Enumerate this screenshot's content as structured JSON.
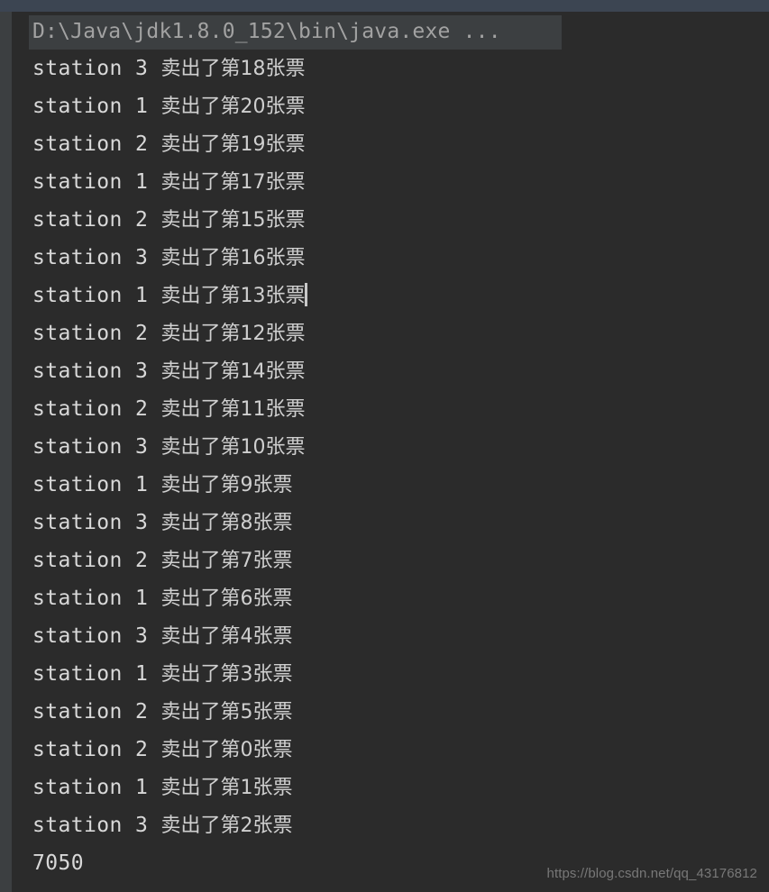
{
  "toolbar": {
    "progress_percent": 26,
    "track_color": "#3c4552",
    "fill_color": "#4a86c8"
  },
  "console": {
    "header_command": "D:\\Java\\jdk1.8.0_152\\bin\\java.exe ...",
    "background_color": "#2b2b2b",
    "gutter_color": "#3c3f41",
    "text_color": "#d4d4d4",
    "caret_line_index": 6,
    "lines": [
      {
        "ascii": "station 3 ",
        "cjk": "卖出了第18张票"
      },
      {
        "ascii": "station 1 ",
        "cjk": "卖出了第20张票"
      },
      {
        "ascii": "station 2 ",
        "cjk": "卖出了第19张票"
      },
      {
        "ascii": "station 1 ",
        "cjk": "卖出了第17张票"
      },
      {
        "ascii": "station 2 ",
        "cjk": "卖出了第15张票"
      },
      {
        "ascii": "station 3 ",
        "cjk": "卖出了第16张票"
      },
      {
        "ascii": "station 1 ",
        "cjk": "卖出了第13张票"
      },
      {
        "ascii": "station 2 ",
        "cjk": "卖出了第12张票"
      },
      {
        "ascii": "station 3 ",
        "cjk": "卖出了第14张票"
      },
      {
        "ascii": "station 2 ",
        "cjk": "卖出了第11张票"
      },
      {
        "ascii": "station 3 ",
        "cjk": "卖出了第10张票"
      },
      {
        "ascii": "station 1 ",
        "cjk": "卖出了第9张票"
      },
      {
        "ascii": "station 3 ",
        "cjk": "卖出了第8张票"
      },
      {
        "ascii": "station 2 ",
        "cjk": "卖出了第7张票"
      },
      {
        "ascii": "station 1 ",
        "cjk": "卖出了第6张票"
      },
      {
        "ascii": "station 3 ",
        "cjk": "卖出了第4张票"
      },
      {
        "ascii": "station 1 ",
        "cjk": "卖出了第3张票"
      },
      {
        "ascii": "station 2 ",
        "cjk": "卖出了第5张票"
      },
      {
        "ascii": "station 2 ",
        "cjk": "卖出了第0张票"
      },
      {
        "ascii": "station 1 ",
        "cjk": "卖出了第1张票"
      },
      {
        "ascii": "station 3 ",
        "cjk": "卖出了第2张票"
      },
      {
        "ascii": "7050",
        "cjk": ""
      }
    ]
  },
  "watermark": {
    "text": "https://blog.csdn.net/qq_43176812"
  }
}
